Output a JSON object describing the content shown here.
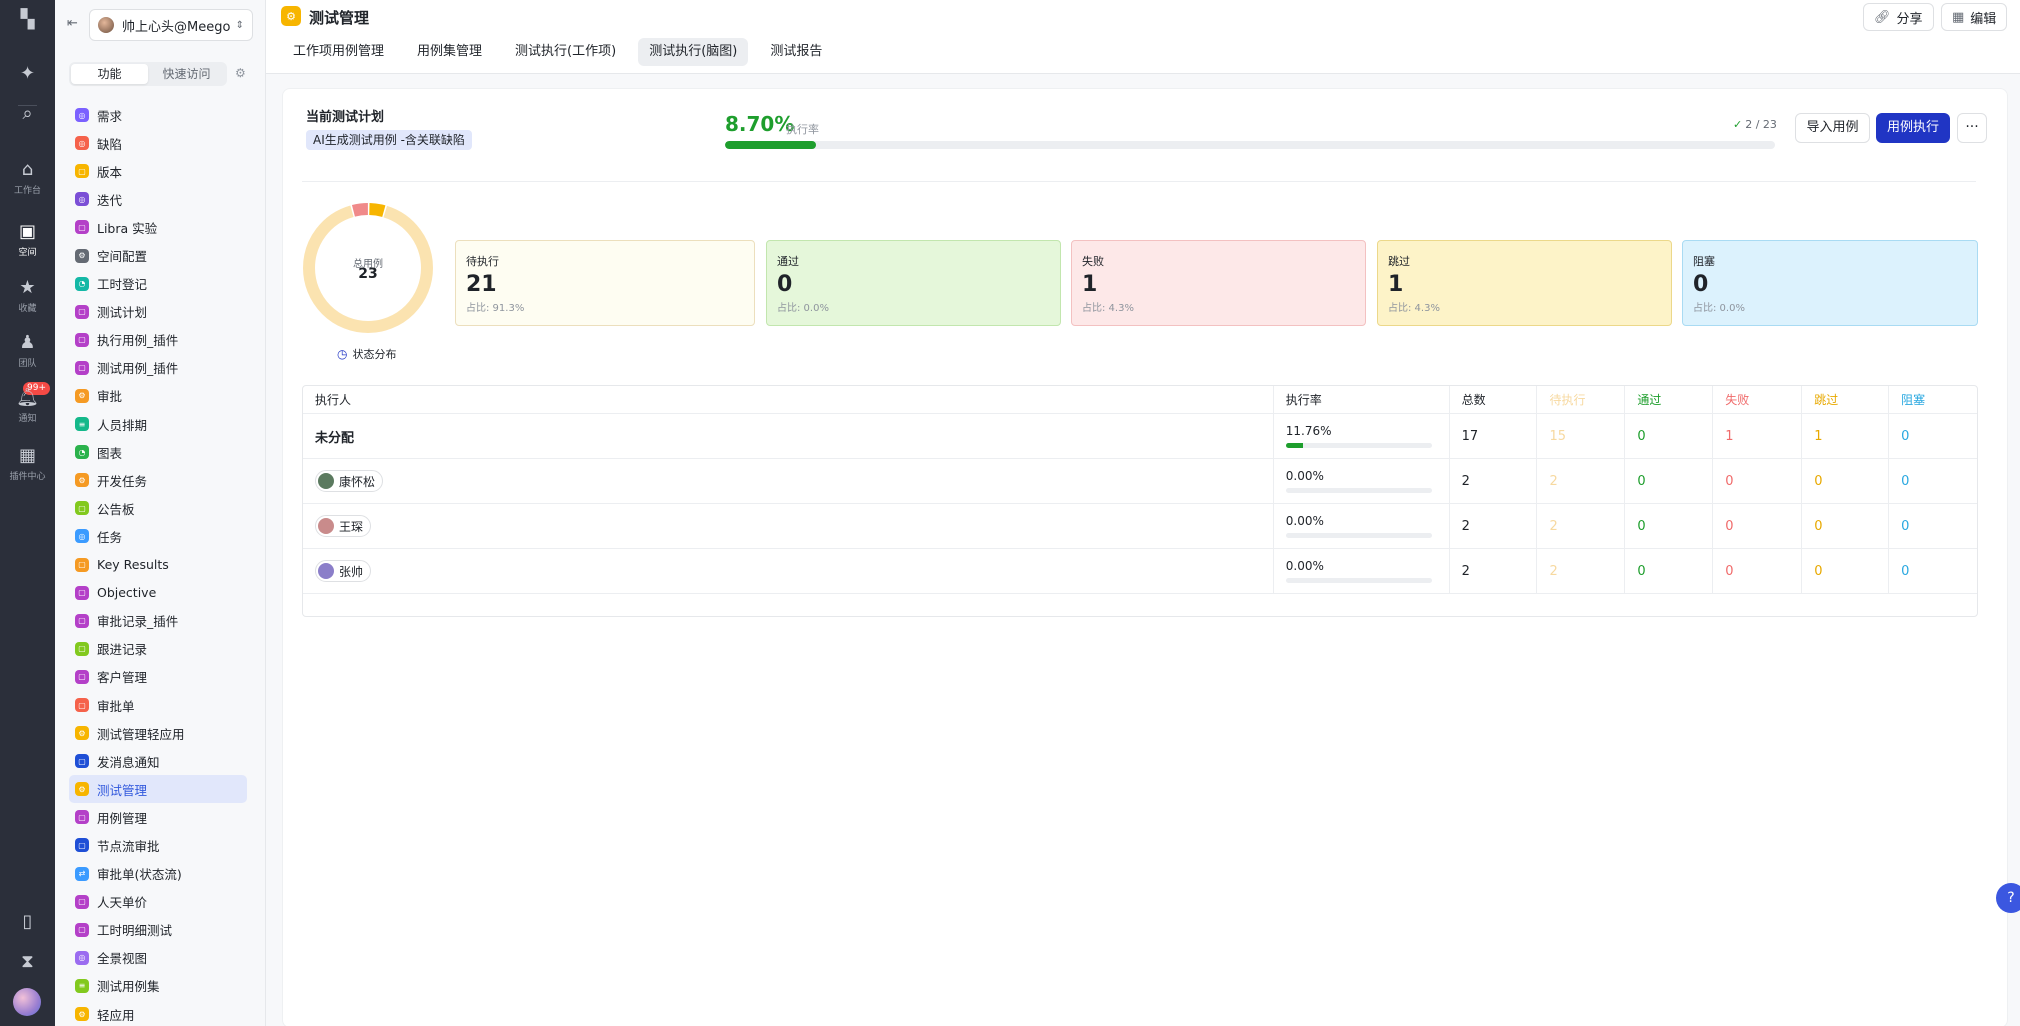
{
  "rail": {
    "items": [
      {
        "name": "logo-icon",
        "glyph": "▚",
        "label": ""
      },
      {
        "name": "ai-icon",
        "glyph": "✦",
        "label": ""
      },
      {
        "name": "search-icon",
        "glyph": "⌕",
        "label": ""
      },
      {
        "name": "home-icon",
        "glyph": "⌂",
        "label": "工作台"
      },
      {
        "name": "space-icon",
        "glyph": "▣",
        "label": "空间"
      },
      {
        "name": "star-icon",
        "glyph": "★",
        "label": "收藏"
      },
      {
        "name": "team-icon",
        "glyph": "♟",
        "label": "团队"
      },
      {
        "name": "bell-icon",
        "glyph": "🔔︎",
        "label": "通知"
      },
      {
        "name": "apps-icon",
        "glyph": "▦",
        "label": "插件中心"
      },
      {
        "name": "phone-icon",
        "glyph": "▯",
        "label": ""
      },
      {
        "name": "hourglass-icon",
        "glyph": "⧗",
        "label": ""
      }
    ],
    "notify_badge": "99+"
  },
  "sidebar": {
    "space_name": "帅上心头@Meego",
    "segments": [
      "功能",
      "快速访问"
    ],
    "items": [
      {
        "label": "需求",
        "color": "#7b61ff",
        "glyph": "◎"
      },
      {
        "label": "缺陷",
        "color": "#f5624b",
        "glyph": "◎"
      },
      {
        "label": "版本",
        "color": "#f7b500",
        "glyph": "▢"
      },
      {
        "label": "迭代",
        "color": "#7b4fd6",
        "glyph": "◎"
      },
      {
        "label": "Libra 实验",
        "color": "#b440c8",
        "glyph": "▢"
      },
      {
        "label": "空间配置",
        "color": "#646a73",
        "glyph": "⚙"
      },
      {
        "label": "工时登记",
        "color": "#14b8a6",
        "glyph": "◔"
      },
      {
        "label": "测试计划",
        "color": "#b440c8",
        "glyph": "▢"
      },
      {
        "label": "执行用例_插件",
        "color": "#b440c8",
        "glyph": "▢"
      },
      {
        "label": "测试用例_插件",
        "color": "#b440c8",
        "glyph": "▢"
      },
      {
        "label": "审批",
        "color": "#f59a23",
        "glyph": "⚙"
      },
      {
        "label": "人员排期",
        "color": "#14b88a",
        "glyph": "≡"
      },
      {
        "label": "图表",
        "color": "#2bb24c",
        "glyph": "◔"
      },
      {
        "label": "开发任务",
        "color": "#f59a23",
        "glyph": "⚙"
      },
      {
        "label": "公告板",
        "color": "#82c91e",
        "glyph": "▢"
      },
      {
        "label": "任务",
        "color": "#3b9bff",
        "glyph": "◎"
      },
      {
        "label": "Key Results",
        "color": "#f59a23",
        "glyph": "▢"
      },
      {
        "label": "Objective",
        "color": "#b440c8",
        "glyph": "▢"
      },
      {
        "label": "审批记录_插件",
        "color": "#b440c8",
        "glyph": "▢"
      },
      {
        "label": "跟进记录",
        "color": "#82c91e",
        "glyph": "▢"
      },
      {
        "label": "客户管理",
        "color": "#b440c8",
        "glyph": "▢"
      },
      {
        "label": "审批单",
        "color": "#f5624b",
        "glyph": "▢"
      },
      {
        "label": "测试管理轻应用",
        "color": "#f7b500",
        "glyph": "⚙"
      },
      {
        "label": "发消息通知",
        "color": "#1f4fd6",
        "glyph": "▢"
      },
      {
        "label": "测试管理",
        "color": "#f7b500",
        "glyph": "⚙"
      },
      {
        "label": "用例管理",
        "color": "#b440c8",
        "glyph": "▢"
      },
      {
        "label": "节点流审批",
        "color": "#1f4fd6",
        "glyph": "▢"
      },
      {
        "label": "审批单(状态流)",
        "color": "#3b9bff",
        "glyph": "⇄"
      },
      {
        "label": "人天单价",
        "color": "#b440c8",
        "glyph": "▢"
      },
      {
        "label": "工时明细测试",
        "color": "#b440c8",
        "glyph": "▢"
      },
      {
        "label": "全景视图",
        "color": "#9b6cf0",
        "glyph": "◎"
      },
      {
        "label": "测试用例集",
        "color": "#82c91e",
        "glyph": "≡"
      },
      {
        "label": "轻应用",
        "color": "#f7b500",
        "glyph": "⚙"
      }
    ],
    "active_index": 24
  },
  "header": {
    "title": "测试管理",
    "share_label": "分享",
    "edit_label": "编辑",
    "tabs": [
      "工作项用例管理",
      "用例集管理",
      "测试执行(工作项)",
      "测试执行(脑图)",
      "测试报告"
    ],
    "active_tab": 3
  },
  "plan": {
    "label": "当前测试计划",
    "name": "AI生成测试用例 -含关联缺陷",
    "rate_value": "8.70%",
    "rate_label": "执行率",
    "rate_fraction": 0.087,
    "count_text": "2 / 23",
    "import_label": "导入用例",
    "exec_label": "用例执行",
    "more_label": "···"
  },
  "summary": {
    "donut_label": "总用例",
    "total": "23",
    "dist_label": "状态分布",
    "donut_segments": [
      {
        "status": "待执行",
        "value": 21,
        "color": "#fbe3b0"
      },
      {
        "status": "失败",
        "value": 1,
        "color": "#f08a8a"
      },
      {
        "status": "跳过",
        "value": 1,
        "color": "#f7b500"
      }
    ],
    "cards": [
      {
        "label": "待执行",
        "value": "21",
        "pct": "占比: 91.3%",
        "bg": "#fefdf2",
        "border": "#ecdfbd"
      },
      {
        "label": "通过",
        "value": "0",
        "pct": "占比: 0.0%",
        "bg": "#e5f7da",
        "border": "#c2e6ae"
      },
      {
        "label": "失败",
        "value": "1",
        "pct": "占比: 4.3%",
        "bg": "#fde8e8",
        "border": "#f3c1c1"
      },
      {
        "label": "跳过",
        "value": "1",
        "pct": "占比: 4.3%",
        "bg": "#fdf3c8",
        "border": "#ecd88a"
      },
      {
        "label": "阻塞",
        "value": "0",
        "pct": "占比: 0.0%",
        "bg": "#dcf2fd",
        "border": "#a9dbf3"
      }
    ]
  },
  "table": {
    "headers": [
      "执行人",
      "执行率",
      "总数",
      "待执行",
      "通过",
      "失败",
      "跳过",
      "阻塞"
    ],
    "header_colors": [
      "#1f2329",
      "#1f2329",
      "#1f2329",
      "#f7d9a0",
      "#1e9e2d",
      "#f06b6b",
      "#e8a900",
      "#2aa8e0"
    ],
    "rows": [
      {
        "person": "未分配",
        "avatar": "",
        "rate": "11.76%",
        "rate_fraction": 0.1176,
        "total": "17",
        "pending": "15",
        "pass": "0",
        "fail": "1",
        "skip": "1",
        "block": "0"
      },
      {
        "person": "康怀松",
        "avatar": "#5b7a5f",
        "rate": "0.00%",
        "rate_fraction": 0,
        "total": "2",
        "pending": "2",
        "pass": "0",
        "fail": "0",
        "skip": "0",
        "block": "0"
      },
      {
        "person": "王琛",
        "avatar": "#c98b8b",
        "rate": "0.00%",
        "rate_fraction": 0,
        "total": "2",
        "pending": "2",
        "pass": "0",
        "fail": "0",
        "skip": "0",
        "block": "0"
      },
      {
        "person": "张帅",
        "avatar": "#8b7ec9",
        "rate": "0.00%",
        "rate_fraction": 0,
        "total": "2",
        "pending": "2",
        "pass": "0",
        "fail": "0",
        "skip": "0",
        "block": "0"
      }
    ]
  },
  "help_label": "?"
}
